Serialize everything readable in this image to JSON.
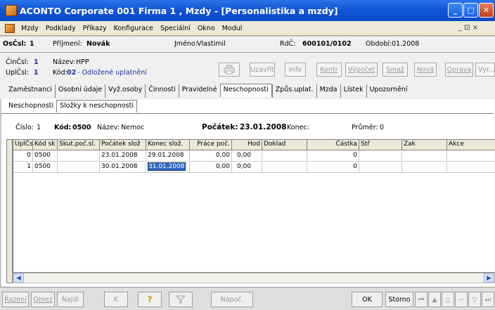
{
  "window": {
    "title": "ACONTO Corporate 001 Firma 1 , Mzdy - [Personalistika a mzdy]",
    "mdi_controls": "_ ⊡ ×"
  },
  "menu": [
    "Mzdy",
    "Podklady",
    "Příkazy",
    "Konfigurace",
    "Speciální",
    "Okno",
    "Modul"
  ],
  "header": {
    "oscsl_label": "OsČsl:",
    "oscsl_value": "1",
    "prijmeni_label": "Příjmení:",
    "prijmeni_value": "Novák",
    "jmeno_label": "Jméno:",
    "jmeno_value": "Vlastimil",
    "rc_label": "RdČ:",
    "rc_value": "600101/0102",
    "obdobi_label": "Období:",
    "obdobi_value": "01.2008",
    "cincsl_label": "ČinČsl:",
    "cincsl_value": "1",
    "nazev_label": "Název:",
    "nazev_value": "HPP",
    "uplcsl_label": "UplČsl:",
    "uplcsl_value": "1",
    "kod_label": "Kód:",
    "kod_value": "02",
    "kod_desc": "- Odložené uplatnění"
  },
  "toolbar": {
    "print_icon": "printer-icon",
    "buttons": [
      "Uzavřít",
      "Info",
      "Kontr",
      "Výpočet",
      "Smaž",
      "Nová",
      "Oprava",
      "Vyr..."
    ]
  },
  "tabs": [
    "Zaměstnanci",
    "Osobní údaje",
    "Vyž.osoby",
    "Činnosti",
    "Pravidelné",
    "Neschopnosti",
    "Způs.uplat.",
    "Mzda",
    "Lístek",
    "Upozornění"
  ],
  "active_tab": "Neschopnosti",
  "subtabs": [
    "Neschopnosti",
    "Složky k neschopnosti"
  ],
  "active_subtab": "Složky k neschopnosti",
  "info": {
    "cislo_label": "Číslo:",
    "cislo_value": "1",
    "kod_label": "Kód:",
    "kod_value": "0500",
    "nazev_label": "Název:",
    "nazev_value": "Nemoc",
    "pocatek_label": "Počátek:",
    "pocatek_value": "23.01.2008",
    "konec_label": "Konec:",
    "prumer_label": "Průměr:",
    "prumer_value": "0"
  },
  "grid": {
    "columns": [
      "UplČsl",
      "Kód sk",
      "Skut.poč.sl.",
      "Počátek slož",
      "Konec slož.",
      "Práce poč.",
      "Hod",
      "Doklad",
      "Částka",
      "Stř",
      "Zak",
      "Akce"
    ],
    "rows": [
      [
        "0",
        "0500",
        "",
        "23.01.2008",
        "29.01.2008",
        "0,00",
        "0,00",
        "",
        "0",
        "",
        "",
        ""
      ],
      [
        "1",
        "0500",
        "",
        "30.01.2008",
        "31.01.2008",
        "0,00",
        "0,00",
        "",
        "0",
        "",
        "",
        ""
      ]
    ]
  },
  "bottom": {
    "buttons": [
      "Řazení",
      "Omez",
      "Najdi",
      "K",
      "?",
      "",
      "Nápoč.",
      "OK",
      "Storno"
    ]
  }
}
